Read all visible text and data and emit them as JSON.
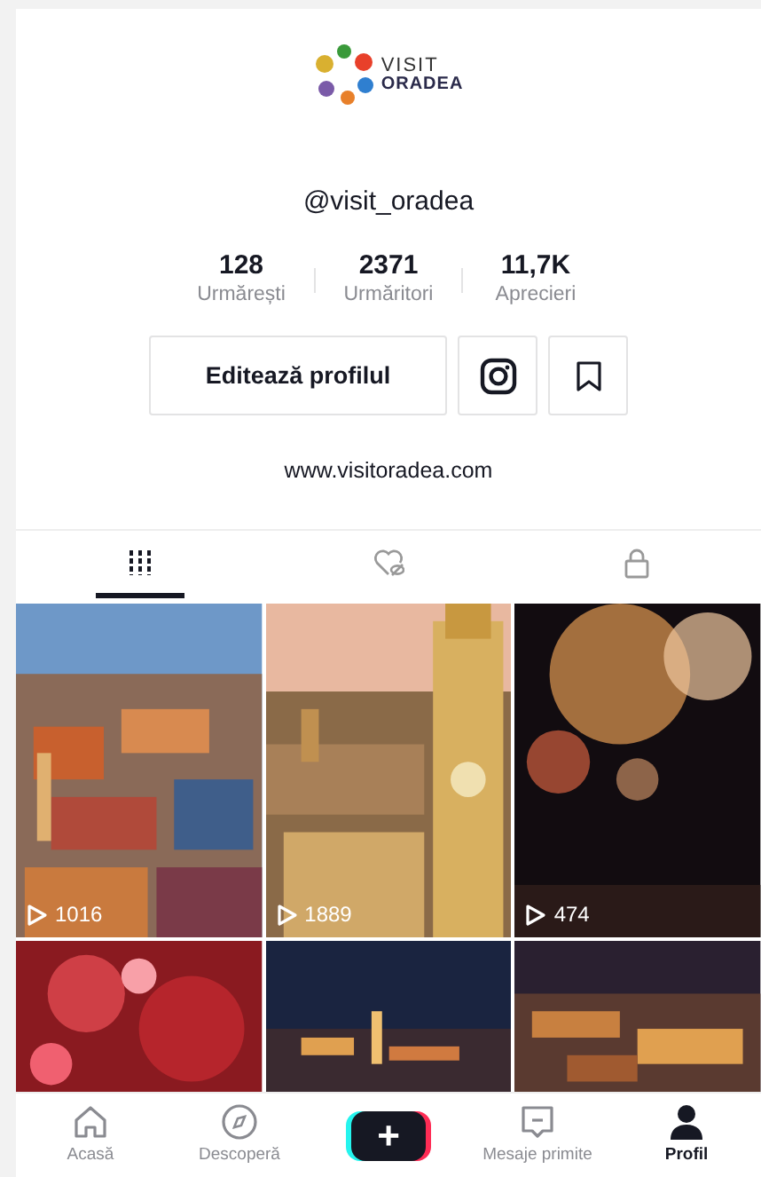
{
  "logo": {
    "line1": "VISIT",
    "line2": "ORADEA"
  },
  "username": "@visit_oradea",
  "stats": [
    {
      "value": "128",
      "label": "Urmărești"
    },
    {
      "value": "2371",
      "label": "Urmăritori"
    },
    {
      "value": "11,7K",
      "label": "Aprecieri"
    }
  ],
  "edit_button": "Editează profilul",
  "website": "www.visitoradea.com",
  "tabs": [
    {
      "kind": "videos",
      "selected": true
    },
    {
      "kind": "liked",
      "selected": false
    },
    {
      "kind": "private",
      "selected": false
    }
  ],
  "videos": [
    {
      "kind": "picture",
      "views": "1016"
    },
    {
      "kind": "picture",
      "views": "1889"
    },
    {
      "kind": "picture",
      "views": "474"
    },
    {
      "kind": "picture"
    },
    {
      "kind": "picture"
    },
    {
      "kind": "picture"
    }
  ],
  "bottom_nav": [
    {
      "kind": "home",
      "label": "Acasă",
      "selected": false
    },
    {
      "kind": "discover",
      "label": "Descoperă",
      "selected": false
    },
    {
      "kind": "create",
      "label": "+",
      "selected": false
    },
    {
      "kind": "inbox",
      "label": "Mesaje primite",
      "selected": false
    },
    {
      "kind": "profile",
      "label": "Profil",
      "selected": true
    }
  ]
}
